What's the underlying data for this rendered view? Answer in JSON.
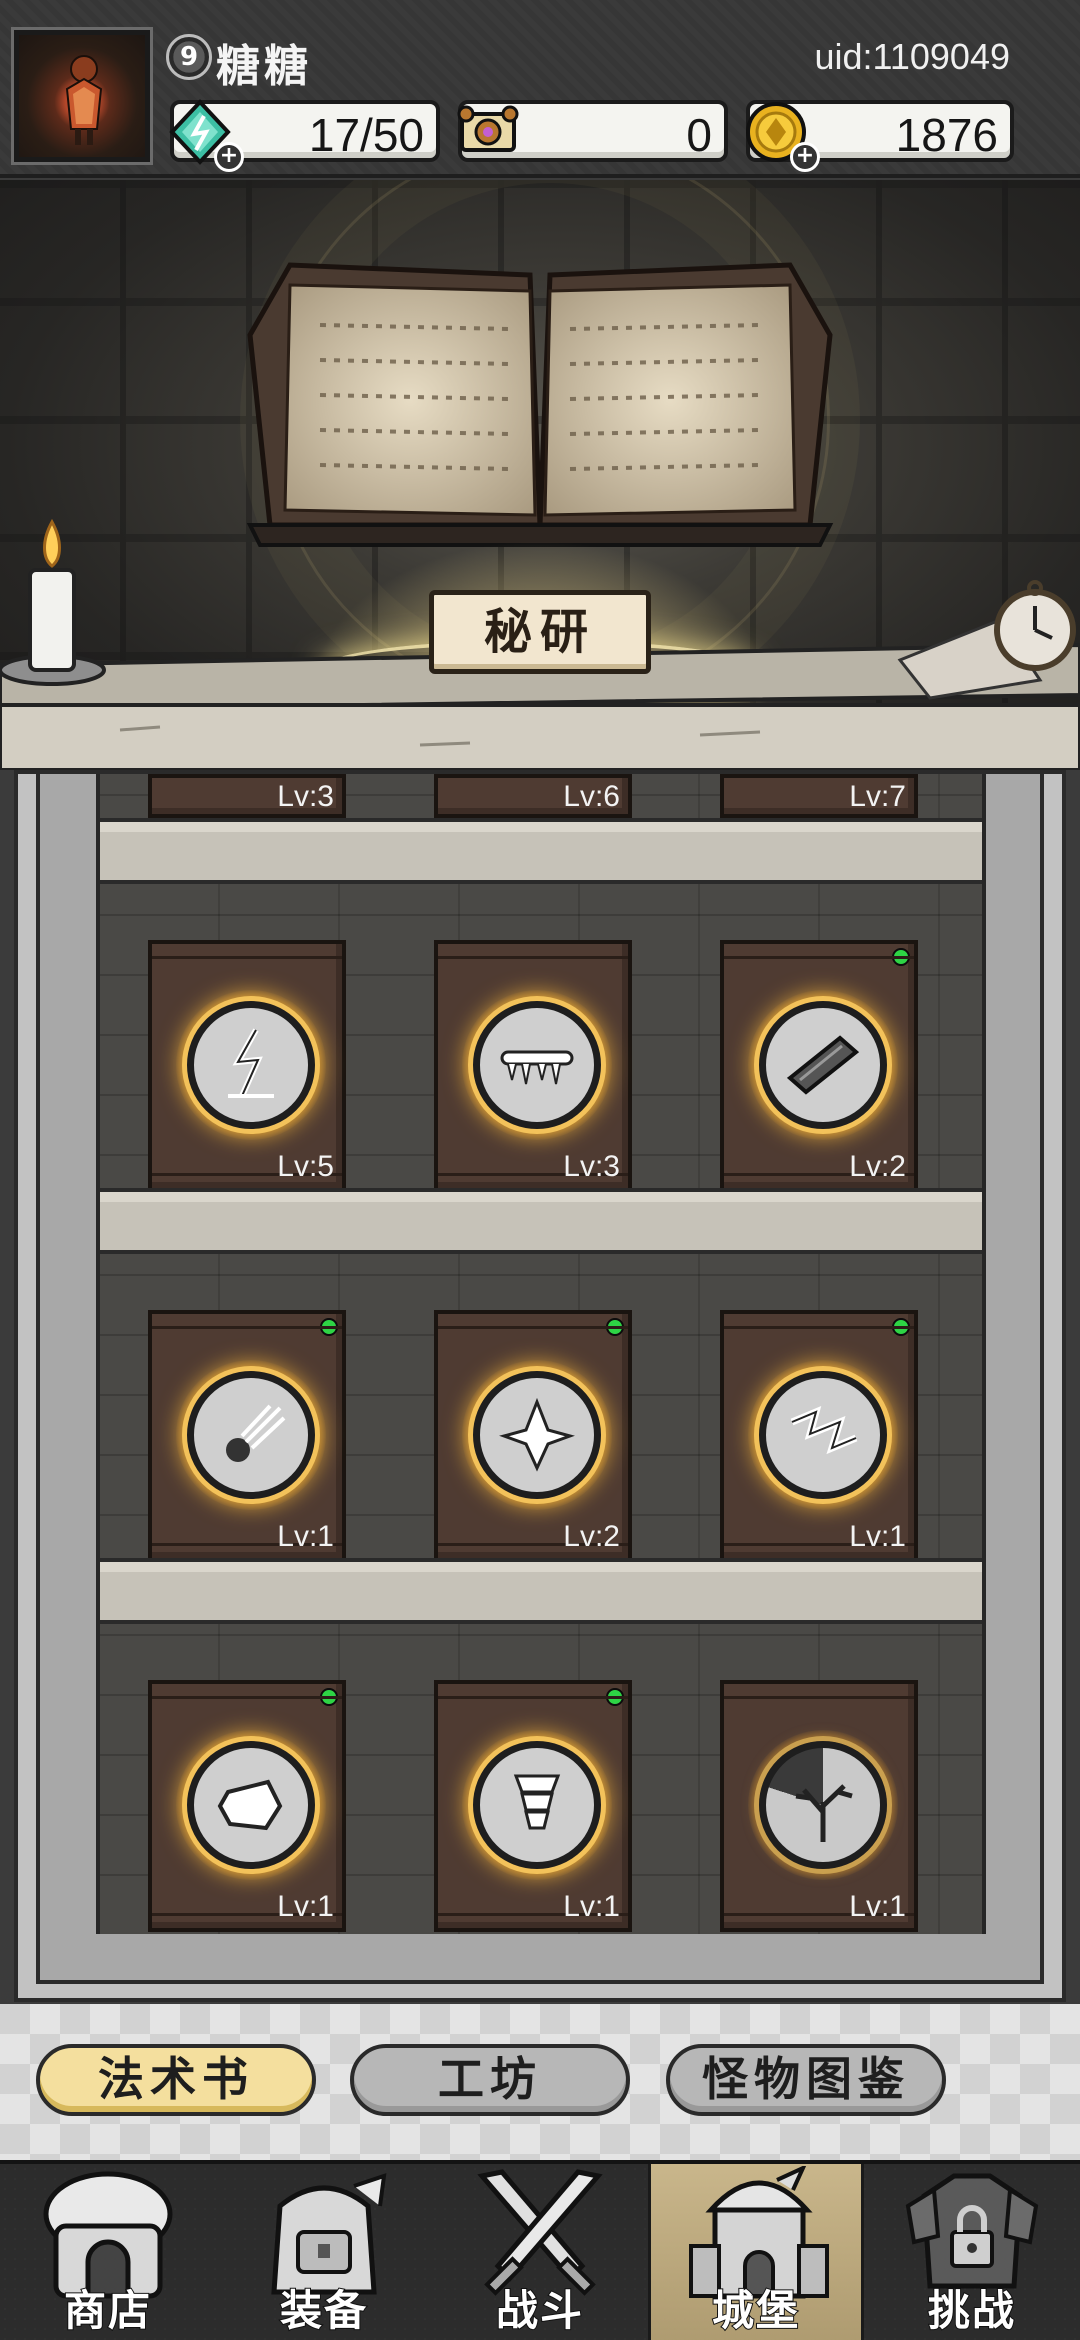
{
  "player": {
    "level": "9",
    "name": "糖糖",
    "uid": "uid:1109049"
  },
  "resources": [
    {
      "name": "energy",
      "icon": "lightning-gem-icon",
      "value": "17/50",
      "has_plus": true
    },
    {
      "name": "ticket",
      "icon": "treasure-map-icon",
      "value": "0",
      "has_plus": false
    },
    {
      "name": "coins",
      "icon": "gold-coin-icon",
      "value": "1876",
      "has_plus": true
    }
  ],
  "scene": {
    "research_button": "秘研"
  },
  "spellbooks": {
    "top_row_partial": [
      {
        "level": "Lv:3"
      },
      {
        "level": "Lv:6"
      },
      {
        "level": "Lv:7"
      }
    ],
    "rows": [
      [
        {
          "icon": "lightning-strike-icon",
          "level": "Lv:5",
          "new": false
        },
        {
          "icon": "icicles-icon",
          "level": "Lv:3",
          "new": false
        },
        {
          "icon": "fire-log-icon",
          "level": "Lv:2",
          "new": true
        }
      ],
      [
        {
          "icon": "meteor-icon",
          "level": "Lv:1",
          "new": true
        },
        {
          "icon": "ice-crystal-icon",
          "level": "Lv:2",
          "new": true
        },
        {
          "icon": "chain-lightning-icon",
          "level": "Lv:1",
          "new": true
        }
      ],
      [
        {
          "icon": "rock-shield-icon",
          "level": "Lv:1",
          "new": true
        },
        {
          "icon": "tornado-icon",
          "level": "Lv:1",
          "new": true
        },
        {
          "icon": "thunder-tree-icon",
          "level": "Lv:1",
          "new": false
        }
      ]
    ]
  },
  "tabs": [
    {
      "label": "法术书",
      "active": true
    },
    {
      "label": "工坊",
      "active": false
    },
    {
      "label": "怪物图鉴",
      "active": false
    }
  ],
  "nav": [
    {
      "label": "商店",
      "icon": "shop-house-icon",
      "active": false
    },
    {
      "label": "装备",
      "icon": "backpack-icon",
      "active": false
    },
    {
      "label": "战斗",
      "icon": "crossed-swords-icon",
      "active": false
    },
    {
      "label": "城堡",
      "icon": "castle-tower-icon",
      "active": true
    },
    {
      "label": "挑战",
      "icon": "locked-armor-icon",
      "active": false
    }
  ]
}
